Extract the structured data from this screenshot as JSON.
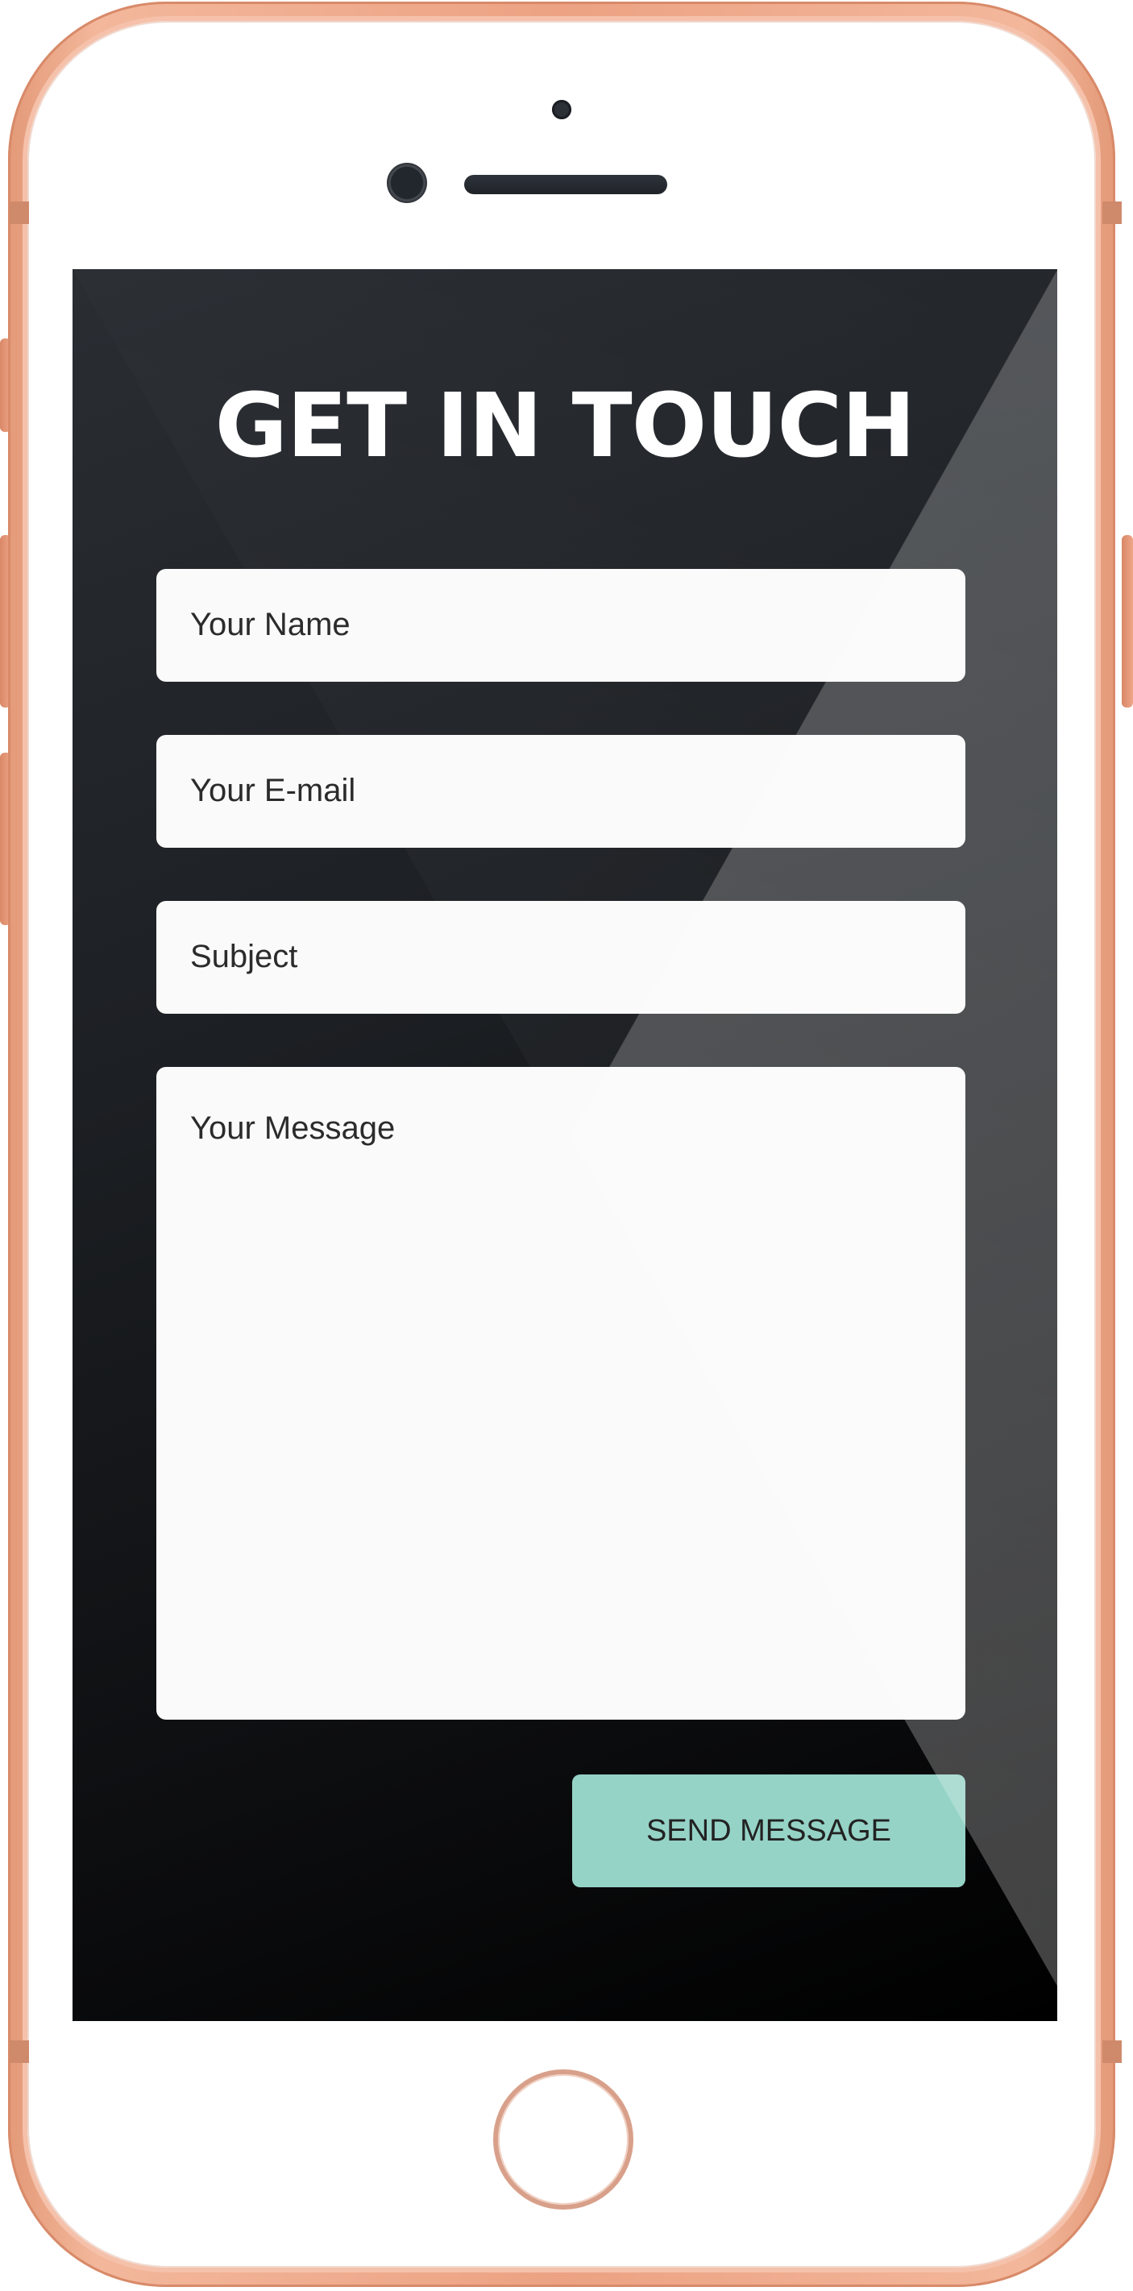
{
  "device": {
    "frame_color": "#eca283",
    "screen_color": "#1c1f23"
  },
  "form": {
    "title": "GET IN TOUCH",
    "fields": {
      "name_placeholder": "Your Name",
      "email_placeholder": "Your E-mail",
      "subject_placeholder": "Subject",
      "message_placeholder": "Your Message"
    },
    "send_label": "SEND MESSAGE",
    "send_button_color": "#96d3c7"
  }
}
